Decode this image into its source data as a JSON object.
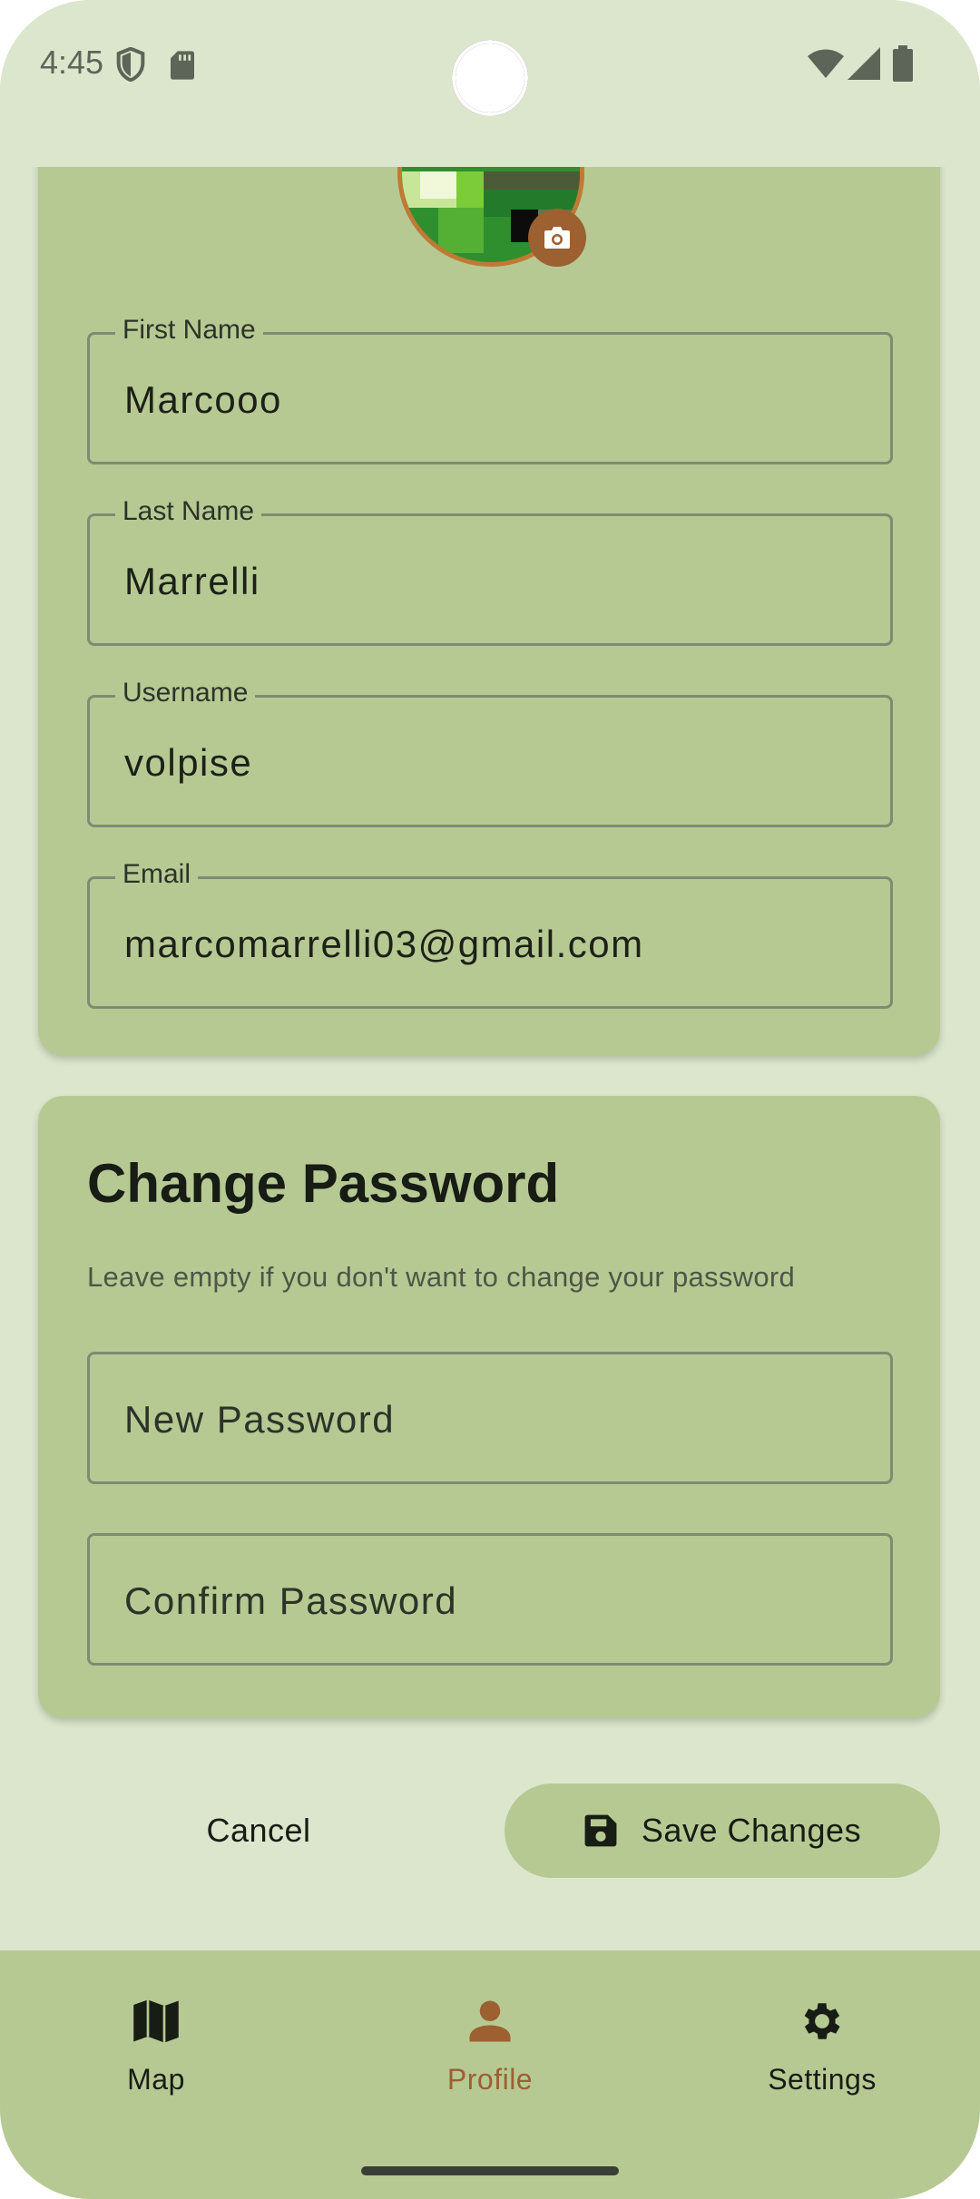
{
  "status_bar": {
    "time": "4:45"
  },
  "profile": {
    "fields": [
      {
        "label": "First Name",
        "value": "Marcooo"
      },
      {
        "label": "Last Name",
        "value": "Marrelli"
      },
      {
        "label": "Username",
        "value": "volpise"
      },
      {
        "label": "Email",
        "value": "marcomarrelli03@gmail.com"
      }
    ]
  },
  "password": {
    "title": "Change Password",
    "subtitle": "Leave empty if you don't want to change your password",
    "new_placeholder": "New Password",
    "confirm_placeholder": "Confirm Password"
  },
  "actions": {
    "cancel_label": "Cancel",
    "save_label": "Save Changes"
  },
  "nav": {
    "items": [
      {
        "label": "Map",
        "icon": "map-icon"
      },
      {
        "label": "Profile",
        "icon": "person-icon"
      },
      {
        "label": "Settings",
        "icon": "gear-icon"
      }
    ],
    "active_index": 1
  },
  "colors": {
    "background": "#dce6cc",
    "card": "#b7c993",
    "accent": "#9c6031",
    "text": "#171c14"
  }
}
